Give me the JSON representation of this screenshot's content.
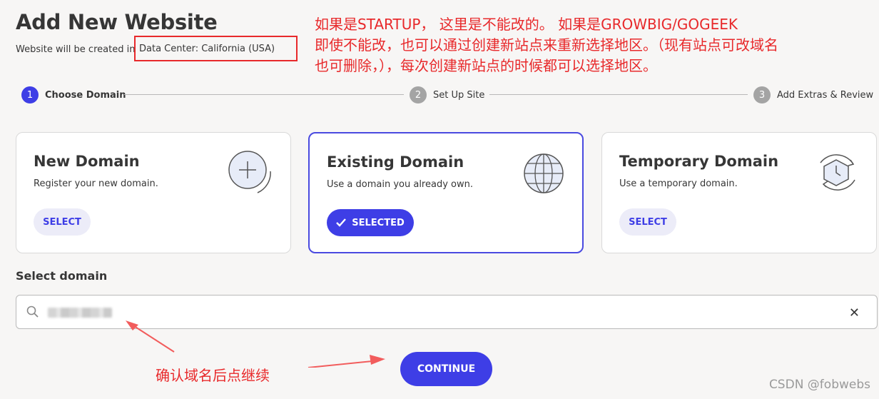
{
  "page": {
    "title": "Add New Website",
    "subtitle_prefix": "Website will be created in",
    "data_center": "Data Center: California (USA)"
  },
  "annotations": {
    "top_note_lines": [
      "如果是STARTUP，  这里是不能改的。 如果是GROWBIG/GOGEEK",
      "即使不能改，也可以通过创建新站点来重新选择地区。（现有站点可改域名",
      "也可删除，），每次创建新站点的时候都可以选择地区。"
    ],
    "confirm_note": "确认域名后点继续",
    "color": "#e8292b"
  },
  "steps": [
    {
      "num": "1",
      "label": "Choose Domain",
      "active": true
    },
    {
      "num": "2",
      "label": "Set Up Site",
      "active": false
    },
    {
      "num": "3",
      "label": "Add Extras & Review",
      "active": false
    }
  ],
  "cards": [
    {
      "title": "New Domain",
      "desc": "Register your new domain.",
      "button": "SELECT",
      "icon": "plus-circle-icon"
    },
    {
      "title": "Existing Domain",
      "desc": "Use a domain you already own.",
      "button": "SELECTED",
      "icon": "globe-icon"
    },
    {
      "title": "Temporary Domain",
      "desc": "Use a temporary domain.",
      "button": "SELECT",
      "icon": "clock-cycle-icon"
    }
  ],
  "select_domain": {
    "label": "Select domain",
    "placeholder": "",
    "value_blurred": true
  },
  "continue_button": "CONTINUE",
  "watermark": "CSDN @fobwebs",
  "colors": {
    "accent": "#3e3ee6",
    "accent_light": "#ececf8",
    "background": "#f7f6f5",
    "annotation_red": "#e8292b"
  }
}
